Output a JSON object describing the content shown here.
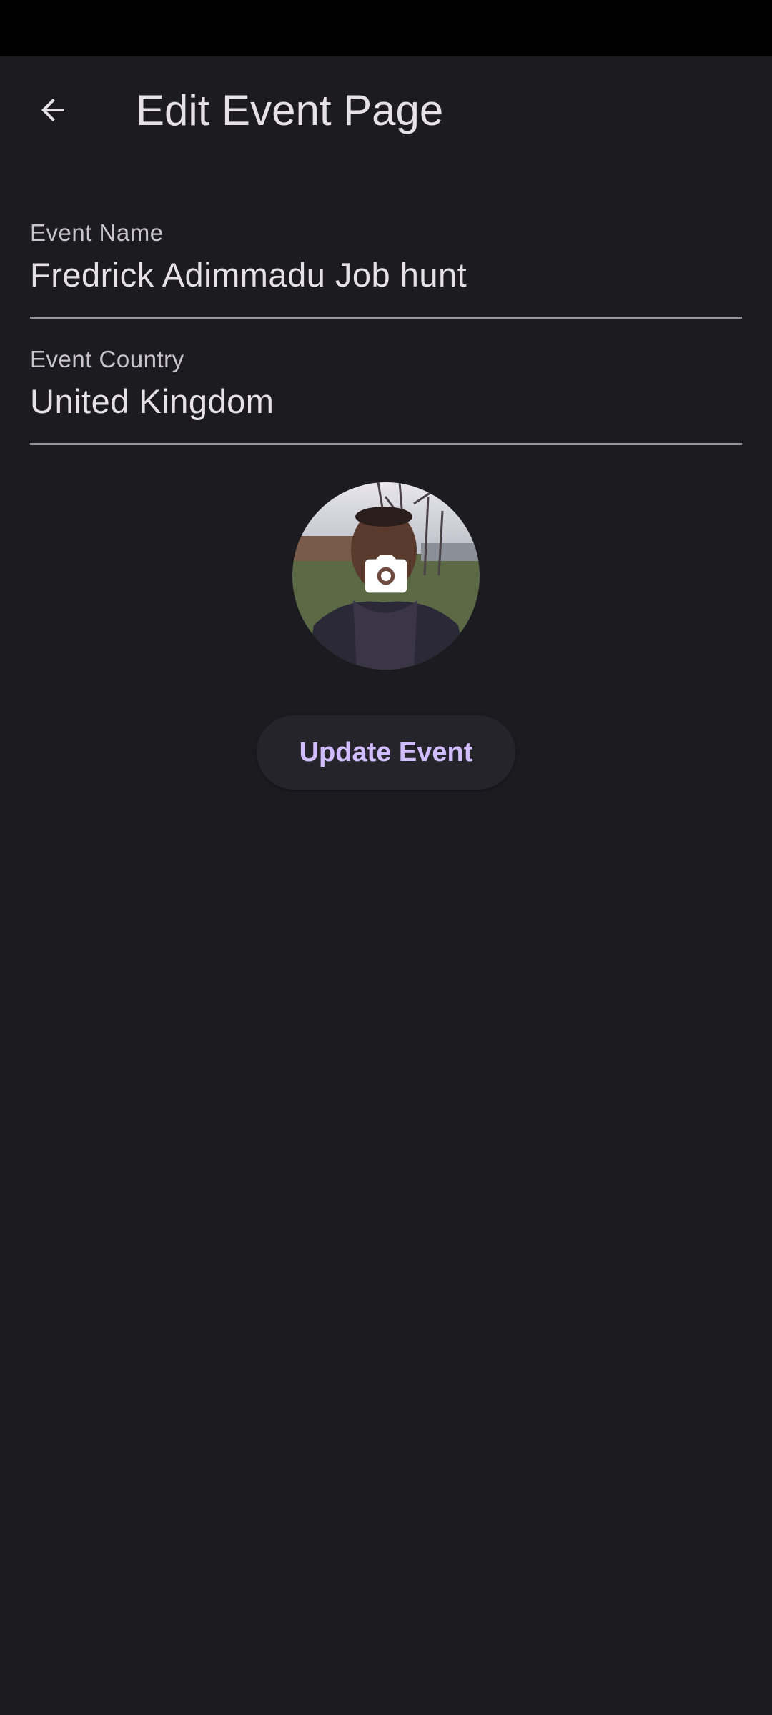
{
  "app_bar": {
    "title": "Edit Event Page",
    "back_icon": "arrow-back-icon"
  },
  "form": {
    "event_name": {
      "label": "Event Name",
      "value": "Fredrick Adimmadu Job hunt"
    },
    "event_country": {
      "label": "Event Country",
      "value": "United Kingdom"
    }
  },
  "avatar": {
    "overlay_icon": "camera-icon"
  },
  "actions": {
    "update_label": "Update Event"
  },
  "colors": {
    "background": "#1c1b20",
    "accent": "#d0bcff",
    "text_primary": "#e6e1e6",
    "text_secondary": "#cac4cf",
    "divider": "#9a959c"
  }
}
